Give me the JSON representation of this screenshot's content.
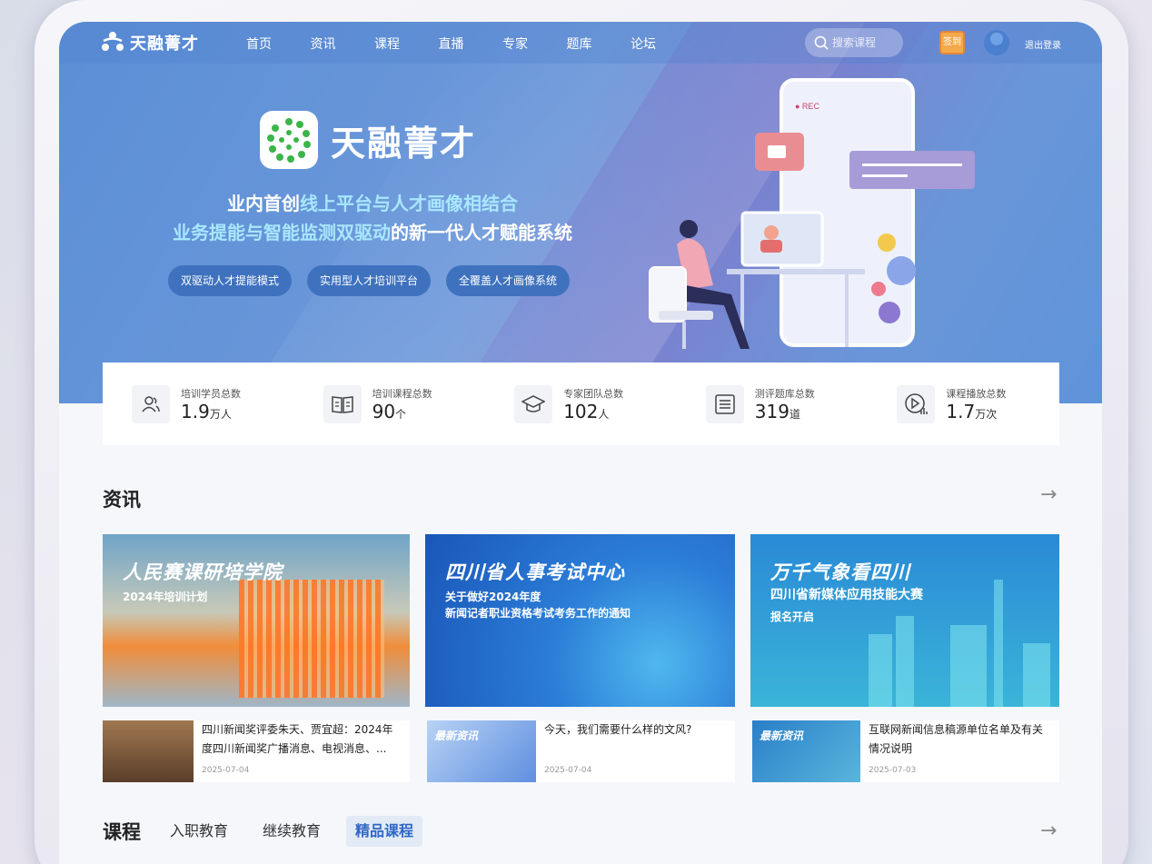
{
  "nav": {
    "logo": "天融菁才",
    "items": [
      "首页",
      "资讯",
      "课程",
      "直播",
      "专家",
      "题库",
      "论坛"
    ],
    "search_placeholder": "搜索课程",
    "checkin": "签到",
    "logout": "退出登录"
  },
  "hero": {
    "brand": "天融菁才",
    "line1_pre": "业内首创",
    "line1_hl": "线上平台与人才画像相结合",
    "line2_hl": "业务提能与智能监测双驱动",
    "line2_post": "的新一代人才赋能系统",
    "pills": [
      "双驱动人才提能模式",
      "实用型人才培训平台",
      "全覆盖人才画像系统"
    ],
    "rec": "● REC"
  },
  "stats": [
    {
      "label": "培训学员总数",
      "value": "1.9",
      "unit": "万人",
      "icon": "users-icon"
    },
    {
      "label": "培训课程总数",
      "value": "90",
      "unit": "个",
      "icon": "book-icon"
    },
    {
      "label": "专家团队总数",
      "value": "102",
      "unit": "人",
      "icon": "graduation-cap-icon"
    },
    {
      "label": "测评题库总数",
      "value": "319",
      "unit": "道",
      "icon": "list-icon"
    },
    {
      "label": "课程播放总数",
      "value": "1.7",
      "unit": "万次",
      "icon": "play-chart-icon"
    }
  ],
  "news": {
    "title": "资讯",
    "banners": [
      {
        "title": "人民赛课研培学院",
        "sub": [
          "2024年培训计划"
        ]
      },
      {
        "title": "四川省人事考试中心",
        "sub": [
          "关于做好2024年度",
          "新闻记者职业资格考试考务工作的通知"
        ]
      },
      {
        "title": "万千气象看四川",
        "sub": [
          "四川省新媒体应用技能大赛",
          "报名开启"
        ]
      }
    ],
    "items": [
      {
        "title": "四川新闻奖评委朱天、贾宜超：2024年度四川新闻奖广播消息、电视消息、...",
        "date": "2025-07-04",
        "thumb_text": ""
      },
      {
        "title": "今天，我们需要什么样的文风?",
        "date": "2025-07-04",
        "thumb_text": "最新资讯"
      },
      {
        "title": "互联网新闻信息稿源单位名单及有关情况说明",
        "date": "2025-07-03",
        "thumb_text": "最新资讯"
      }
    ]
  },
  "courses": {
    "title": "课程",
    "tabs": [
      "入职教育",
      "继续教育",
      "精品课程"
    ],
    "active_tab": "精品课程"
  },
  "colors": {
    "hero_blue": "#5b8fd6",
    "pill_blue": "#3f72be",
    "highlight": "#a8e7ff",
    "checkin_orange": "#f4a94a",
    "active_tab_text": "#2f67c6"
  }
}
